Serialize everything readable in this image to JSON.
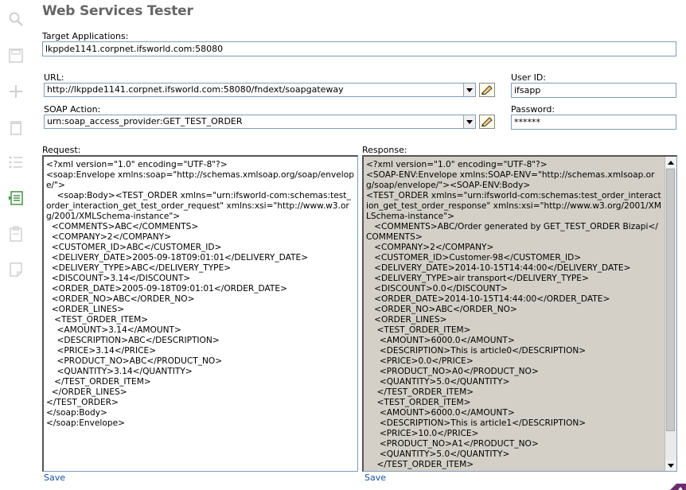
{
  "app": {
    "title": "Web Services Tester"
  },
  "toolbar": {
    "icons": [
      "search-icon",
      "save-icon",
      "add-icon",
      "delete-icon",
      "list-icon",
      "active-list-icon",
      "clipboard-icon",
      "note-icon"
    ]
  },
  "target": {
    "label": "Target Applications:",
    "value": "lkppde1141.corpnet.ifsworld.com:58080"
  },
  "url": {
    "label": "URL:",
    "value": "http://lkppde1141.corpnet.ifsworld.com:58080/fndext/soapgateway"
  },
  "user": {
    "label": "User ID:",
    "value": "ifsapp"
  },
  "soap_action": {
    "label": "SOAP Action:",
    "value": "urn:soap_access_provider:GET_TEST_ORDER"
  },
  "password": {
    "label": "Password:",
    "value": "******"
  },
  "request": {
    "label": "Request:",
    "body": "<?xml version=\"1.0\" encoding=\"UTF-8\"?>\n<soap:Envelope xmlns:soap=\"http://schemas.xmlsoap.org/soap/envelope/\">\n    <soap:Body><TEST_ORDER xmlns=\"urn:ifsworld-com:schemas:test_order_interaction_get_test_order_request\" xmlns:xsi=\"http://www.w3.org/2001/XMLSchema-instance\">\n  <COMMENTS>ABC</COMMENTS>\n  <COMPANY>2</COMPANY>\n  <CUSTOMER_ID>ABC</CUSTOMER_ID>\n  <DELIVERY_DATE>2005-09-18T09:01:01</DELIVERY_DATE>\n  <DELIVERY_TYPE>ABC</DELIVERY_TYPE>\n  <DISCOUNT>3.14</DISCOUNT>\n  <ORDER_DATE>2005-09-18T09:01:01</ORDER_DATE>\n  <ORDER_NO>ABC</ORDER_NO>\n  <ORDER_LINES>\n   <TEST_ORDER_ITEM>\n    <AMOUNT>3.14</AMOUNT>\n    <DESCRIPTION>ABC</DESCRIPTION>\n    <PRICE>3.14</PRICE>\n    <PRODUCT_NO>ABC</PRODUCT_NO>\n    <QUANTITY>3.14</QUANTITY>\n   </TEST_ORDER_ITEM>\n  </ORDER_LINES>\n</TEST_ORDER>\n</soap:Body>\n</soap:Envelope>",
    "save_label": "Save"
  },
  "response": {
    "label": "Response:",
    "body": "<?xml version=\"1.0\" encoding=\"UTF-8\"?>\n<SOAP-ENV:Envelope xmlns:SOAP-ENV=\"http://schemas.xmlsoap.org/soap/envelope/\"><SOAP-ENV:Body>\n<TEST_ORDER xmlns=\"urn:ifsworld-com:schemas:test_order_interaction_get_test_order_response\" xmlns:xsi=\"http://www.w3.org/2001/XMLSchema-instance\">\n   <COMMENTS>ABC/Order generated by GET_TEST_ORDER Bizapi</COMMENTS>\n   <COMPANY>2</COMPANY>\n   <CUSTOMER_ID>Customer-98</CUSTOMER_ID>\n   <DELIVERY_DATE>2014-10-15T14:44:00</DELIVERY_DATE>\n   <DELIVERY_TYPE>air transport</DELIVERY_TYPE>\n   <DISCOUNT>0.0</DISCOUNT>\n   <ORDER_DATE>2014-10-15T14:44:00</ORDER_DATE>\n   <ORDER_NO>ABC</ORDER_NO>\n   <ORDER_LINES>\n    <TEST_ORDER_ITEM>\n     <AMOUNT>6000.0</AMOUNT>\n     <DESCRIPTION>This is article0</DESCRIPTION>\n     <PRICE>0.0</PRICE>\n     <PRODUCT_NO>A0</PRODUCT_NO>\n     <QUANTITY>5.0</QUANTITY>\n    </TEST_ORDER_ITEM>\n    <TEST_ORDER_ITEM>\n     <AMOUNT>6000.0</AMOUNT>\n     <DESCRIPTION>This is article1</DESCRIPTION>\n     <PRICE>10.0</PRICE>\n     <PRODUCT_NO>A1</PRODUCT_NO>\n     <QUANTITY>5.0</QUANTITY>\n    </TEST_ORDER_ITEM>",
    "save_label": "Save"
  },
  "colors": {
    "accent": "#1a4fa0",
    "title": "#666666",
    "response_bg": "#d4d0c8",
    "brand": "#6b2c6e"
  }
}
